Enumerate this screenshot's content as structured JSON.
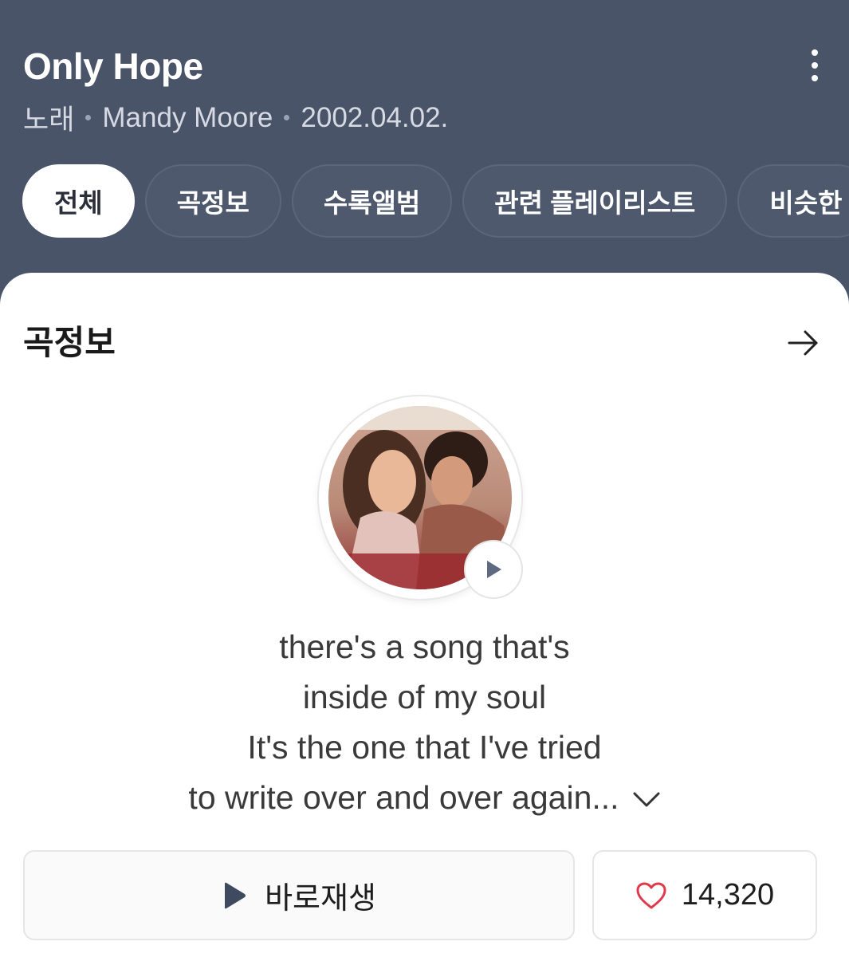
{
  "header": {
    "title": "Only Hope",
    "meta": {
      "type": "노래",
      "artist": "Mandy Moore",
      "date": "2002.04.02."
    }
  },
  "tabs": [
    {
      "label": "전체",
      "active": true
    },
    {
      "label": "곡정보",
      "active": false
    },
    {
      "label": "수록앨범",
      "active": false
    },
    {
      "label": "관련 플레이리스트",
      "active": false
    },
    {
      "label": "비슷한",
      "active": false
    }
  ],
  "section": {
    "title": "곡정보"
  },
  "lyrics": [
    "there's a song that's",
    "inside of my soul",
    "It's the one that I've tried",
    "to write over and over again..."
  ],
  "actions": {
    "play_label": "바로재생",
    "like_count": "14,320"
  },
  "colors": {
    "header_bg": "#4a5469",
    "heart": "#e0394a",
    "play_icon": "#3f4a5e"
  },
  "icons": [
    "more-vertical-icon",
    "arrow-right-icon",
    "play-icon",
    "chevron-down-icon",
    "heart-icon"
  ]
}
